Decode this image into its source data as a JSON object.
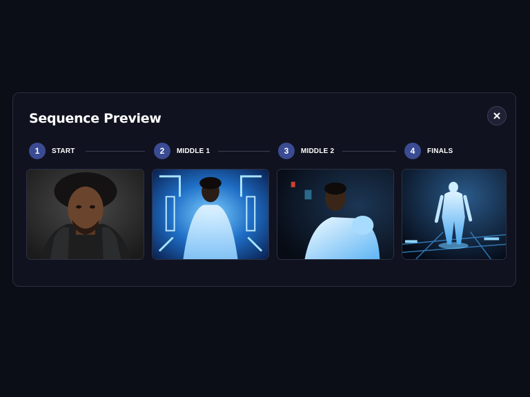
{
  "modal": {
    "title": "Sequence Preview",
    "close_icon": "close-icon"
  },
  "steps": [
    {
      "number": "1",
      "label": "START"
    },
    {
      "number": "2",
      "label": "MIDDLE 1"
    },
    {
      "number": "3",
      "label": "MIDDLE 2"
    },
    {
      "number": "4",
      "label": "FINALS"
    }
  ],
  "colors": {
    "background": "#0b0d17",
    "panel": "#10131f",
    "step_badge": "#3b4b93",
    "glow": "#5ab8ff"
  }
}
